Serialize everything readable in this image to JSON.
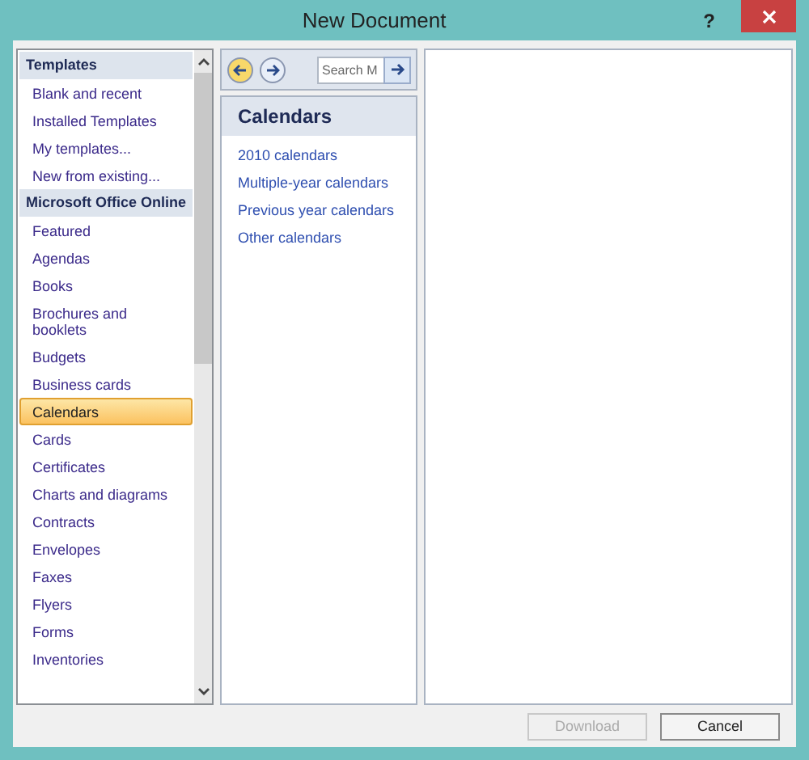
{
  "window": {
    "title": "New Document",
    "help": "?"
  },
  "sidebar": {
    "items": [
      {
        "kind": "header",
        "label": "Templates",
        "selected": false
      },
      {
        "kind": "item",
        "label": "Blank and recent",
        "selected": false
      },
      {
        "kind": "item",
        "label": "Installed Templates",
        "selected": false
      },
      {
        "kind": "item",
        "label": "My templates...",
        "selected": false
      },
      {
        "kind": "item",
        "label": "New from existing...",
        "selected": false
      },
      {
        "kind": "header",
        "label": "Microsoft Office Online",
        "selected": false
      },
      {
        "kind": "item",
        "label": "Featured",
        "selected": false
      },
      {
        "kind": "item",
        "label": "Agendas",
        "selected": false
      },
      {
        "kind": "item",
        "label": "Books",
        "selected": false
      },
      {
        "kind": "item",
        "label": "Brochures and booklets",
        "selected": false
      },
      {
        "kind": "item",
        "label": "Budgets",
        "selected": false
      },
      {
        "kind": "item",
        "label": "Business cards",
        "selected": false
      },
      {
        "kind": "item",
        "label": "Calendars",
        "selected": true
      },
      {
        "kind": "item",
        "label": "Cards",
        "selected": false
      },
      {
        "kind": "item",
        "label": "Certificates",
        "selected": false
      },
      {
        "kind": "item",
        "label": "Charts and diagrams",
        "selected": false
      },
      {
        "kind": "item",
        "label": "Contracts",
        "selected": false
      },
      {
        "kind": "item",
        "label": "Envelopes",
        "selected": false
      },
      {
        "kind": "item",
        "label": "Faxes",
        "selected": false
      },
      {
        "kind": "item",
        "label": "Flyers",
        "selected": false
      },
      {
        "kind": "item",
        "label": "Forms",
        "selected": false
      },
      {
        "kind": "item",
        "label": "Inventories",
        "selected": false
      }
    ]
  },
  "search": {
    "placeholder": "Search M"
  },
  "category": {
    "title": "Calendars",
    "links": [
      "2010 calendars",
      "Multiple-year calendars",
      "Previous year calendars",
      "Other calendars"
    ]
  },
  "buttons": [
    {
      "label": "Download",
      "disabled": true
    },
    {
      "label": "Cancel",
      "disabled": false
    }
  ]
}
